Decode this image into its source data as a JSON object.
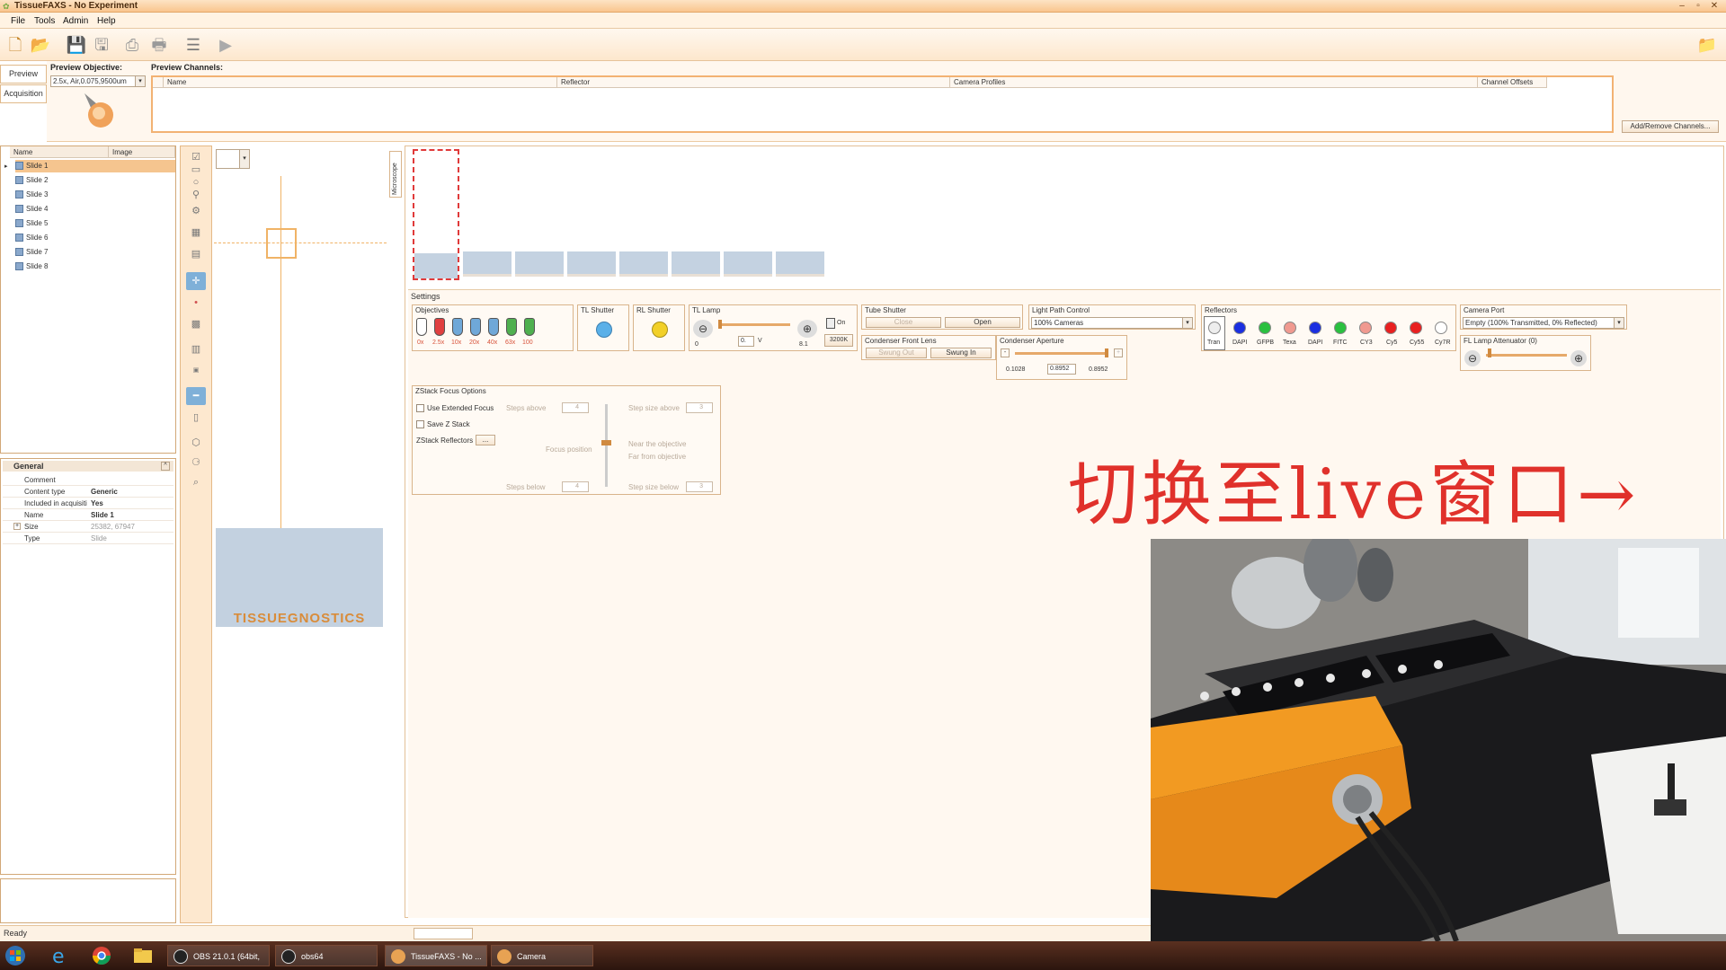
{
  "window": {
    "title": "TissueFAXS - No Experiment"
  },
  "menu": [
    "File",
    "Tools",
    "Admin",
    "Help"
  ],
  "left_tabs": [
    "Preview",
    "Acquisition"
  ],
  "preview": {
    "objective_label": "Preview Objective:",
    "objective_value": "2.5x, Air,0.075,9500um",
    "channels_label": "Preview Channels:",
    "channel_columns": [
      "Name",
      "Reflector",
      "Camera Profiles",
      "Channel Offsets"
    ],
    "add_remove_button": "Add/Remove Channels..."
  },
  "tree": {
    "columns": [
      "Name",
      "Image"
    ],
    "slides": [
      "Slide 1",
      "Slide 2",
      "Slide 3",
      "Slide 4",
      "Slide 5",
      "Slide 6",
      "Slide 7",
      "Slide 8"
    ]
  },
  "properties": {
    "section": "General",
    "rows": [
      {
        "k": "Comment",
        "v": ""
      },
      {
        "k": "Content type",
        "v": "Generic"
      },
      {
        "k": "Included in acquisiti",
        "v": "Yes"
      },
      {
        "k": "Name",
        "v": "Slide 1"
      },
      {
        "k": "Size",
        "v": "25382, 67947"
      },
      {
        "k": "Type",
        "v": "Slide"
      }
    ]
  },
  "logo_text": "TISSUEGNOSTICS",
  "microscope_tab": "Microscope",
  "settings": {
    "title": "Settings",
    "objectives": {
      "title": "Objectives",
      "labels": [
        "0x",
        "2.5x",
        "10x",
        "20x",
        "40x",
        "63x",
        "100"
      ]
    },
    "tl_shutter": "TL Shutter",
    "rl_shutter": "RL Shutter",
    "tl_lamp": {
      "title": "TL Lamp",
      "min": "0",
      "max": "8.1",
      "value": "0.",
      "unit": "V",
      "on": "On",
      "temp": "3200K"
    },
    "tube_shutter": {
      "title": "Tube Shutter",
      "close": "Close",
      "open": "Open"
    },
    "light_path": {
      "title": "Light Path Control",
      "value": "100% Cameras"
    },
    "reflectors": {
      "title": "Reflectors",
      "labels": [
        "Tran",
        "DAPI",
        "GFPB",
        "Texa",
        "DAPI",
        "FITC",
        "CY3",
        "Cy5",
        "Cy55",
        "Cy7R"
      ]
    },
    "camera_port": {
      "title": "Camera Port",
      "value": "Empty (100% Transmitted, 0% Reflected)"
    },
    "fl_lamp": {
      "title": "FL Lamp Attenuator (0)"
    },
    "condenser_front": {
      "title": "Condenser Front Lens",
      "swung_out": "Swung Out",
      "swung_in": "Swung In"
    },
    "condenser_aperture": {
      "title": "Condenser Aperture",
      "min": "0.1028",
      "value": "0.8952",
      "max": "0.8952"
    },
    "zstack": {
      "title": "ZStack Focus Options",
      "use_extended": "Use Extended Focus",
      "save_z": "Save Z Stack",
      "reflectors": "ZStack Reflectors",
      "more": "...",
      "steps_above": "Steps above",
      "steps_above_val": "4",
      "steps_below": "Steps below",
      "steps_below_val": "4",
      "focus_position": "Focus position",
      "step_size_above": "Step size above",
      "step_size_above_val": "3",
      "step_size_below": "Step size below",
      "step_size_below_val": "3",
      "near": "Near the objective",
      "far": "Far from objective"
    }
  },
  "overlay_text": "切换至live窗口→",
  "status": "Ready",
  "taskbar": [
    {
      "label": "OBS 21.0.1 (64bit, ..."
    },
    {
      "label": "obs64"
    },
    {
      "label": "TissueFAXS - No ..."
    },
    {
      "label": "Camera"
    }
  ],
  "colors": {
    "accent": "#f2b273",
    "overlay": "#e0312b",
    "selected": "#f5c58f"
  }
}
